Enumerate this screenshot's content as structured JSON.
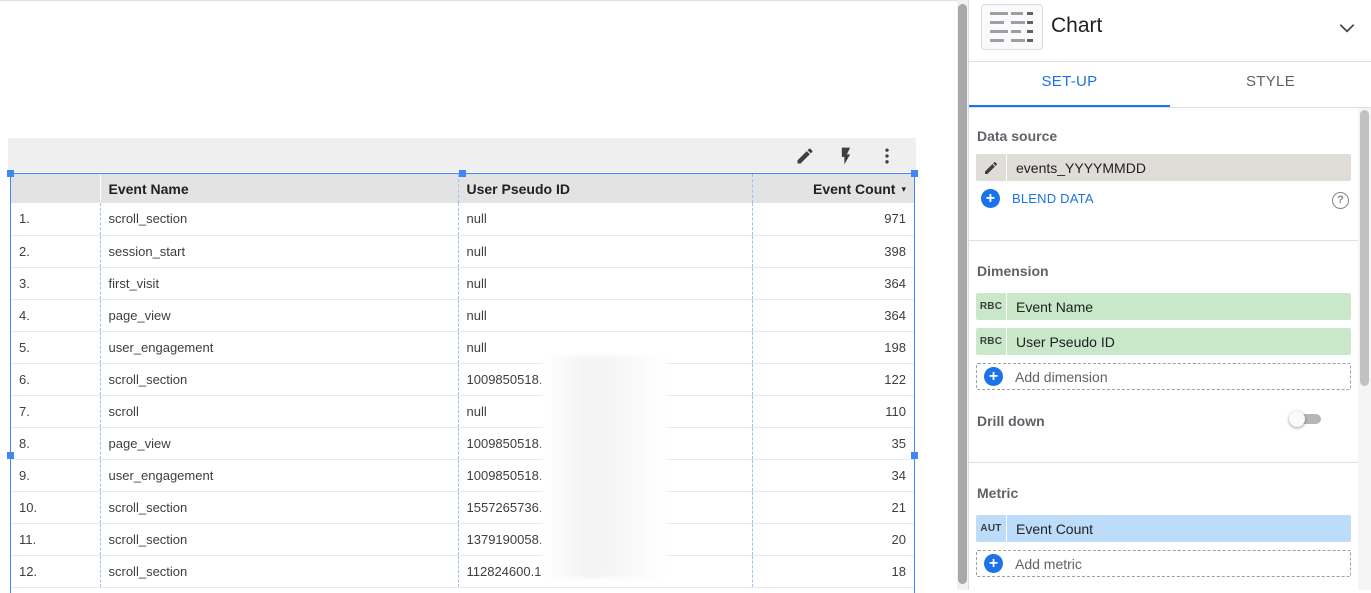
{
  "toolbar": {
    "icons": [
      "pencil-icon",
      "lightning-icon",
      "more-vert-icon"
    ]
  },
  "table": {
    "columns": [
      "",
      "Event Name",
      "User Pseudo ID",
      "Event Count"
    ],
    "sort_indicator": "▾",
    "rows": [
      {
        "index": "1.",
        "event_name": "scroll_section",
        "user_pseudo_id": "null",
        "event_count": "971"
      },
      {
        "index": "2.",
        "event_name": "session_start",
        "user_pseudo_id": "null",
        "event_count": "398"
      },
      {
        "index": "3.",
        "event_name": "first_visit",
        "user_pseudo_id": "null",
        "event_count": "364"
      },
      {
        "index": "4.",
        "event_name": "page_view",
        "user_pseudo_id": "null",
        "event_count": "364"
      },
      {
        "index": "5.",
        "event_name": "user_engagement",
        "user_pseudo_id": "null",
        "event_count": "198"
      },
      {
        "index": "6.",
        "event_name": "scroll_section",
        "user_pseudo_id": "1009850518.",
        "event_count": "122"
      },
      {
        "index": "7.",
        "event_name": "scroll",
        "user_pseudo_id": "null",
        "event_count": "110"
      },
      {
        "index": "8.",
        "event_name": "page_view",
        "user_pseudo_id": "1009850518.",
        "event_count": "35"
      },
      {
        "index": "9.",
        "event_name": "user_engagement",
        "user_pseudo_id": "1009850518.",
        "event_count": "34"
      },
      {
        "index": "10.",
        "event_name": "scroll_section",
        "user_pseudo_id": "1557265736.",
        "event_count": "21"
      },
      {
        "index": "11.",
        "event_name": "scroll_section",
        "user_pseudo_id": "1379190058.",
        "event_count": "20"
      },
      {
        "index": "12.",
        "event_name": "scroll_section",
        "user_pseudo_id": "112824600.1",
        "event_count": "18"
      }
    ]
  },
  "panel": {
    "title": "Chart",
    "chart_type_icon": "table-icon",
    "tabs": [
      {
        "label": "SET-UP",
        "active": true
      },
      {
        "label": "STYLE",
        "active": false
      }
    ],
    "data_source": {
      "label": "Data source",
      "value": "events_YYYYMMDD",
      "blend_label": "BLEND DATA",
      "help": "?"
    },
    "dimension": {
      "label": "Dimension",
      "items": [
        {
          "tag": "RBC",
          "name": "Event Name"
        },
        {
          "tag": "RBC",
          "name": "User Pseudo ID"
        }
      ],
      "add_label": "Add dimension"
    },
    "drill_down": {
      "label": "Drill down",
      "enabled": false
    },
    "metric": {
      "label": "Metric",
      "items": [
        {
          "tag": "AUT",
          "name": "Event Count"
        }
      ],
      "add_label": "Add metric"
    }
  },
  "colors": {
    "accent": "#1a73e8",
    "selection": "#4285f4",
    "dimension_chip": "#c9e7c9",
    "metric_chip": "#bcdcfa"
  }
}
